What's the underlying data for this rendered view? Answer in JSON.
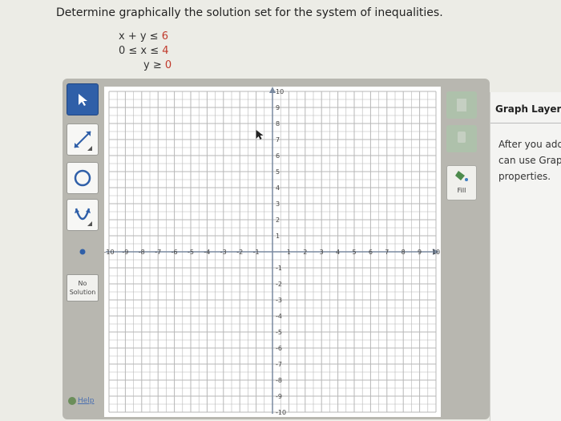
{
  "question": "Determine graphically the solution set for the system of inequalities.",
  "inequalities": [
    {
      "lhs": "x + y ≤ ",
      "rhs": "6"
    },
    {
      "lhs": "0 ≤ x ≤ ",
      "rhs": "4"
    },
    {
      "lhs": "y ≥ ",
      "rhs": "0"
    }
  ],
  "toolbar": {
    "tools": [
      "pointer-icon",
      "line-icon",
      "circle-icon",
      "parabola-icon",
      "point-icon"
    ],
    "no_solution": "No Solution",
    "help": "Help"
  },
  "graph": {
    "x_range": [
      -10,
      10
    ],
    "y_range": [
      -10,
      10
    ],
    "x_ticks": [
      -10,
      -9,
      -8,
      -7,
      -6,
      -5,
      -4,
      -3,
      -2,
      -1,
      1,
      2,
      3,
      4,
      5,
      6,
      7,
      8,
      9,
      10
    ],
    "y_ticks": [
      10,
      9,
      8,
      7,
      6,
      5,
      4,
      3,
      2,
      1,
      -1,
      -2,
      -3,
      -4,
      -5,
      -6,
      -7,
      -8,
      -9,
      -10
    ],
    "grid": true,
    "x_tick_labels": [
      "-10",
      "-9",
      "-8",
      "-7",
      "-6",
      "-5",
      "-4",
      "-3",
      "-2",
      "-1",
      "1",
      "2",
      "3",
      "4",
      "5",
      "6",
      "7",
      "8",
      "9",
      "10"
    ],
    "y_tick_labels": [
      "10",
      "9",
      "8",
      "7",
      "6",
      "5",
      "4",
      "3",
      "2",
      "1",
      "-1",
      "-2",
      "-3",
      "-4",
      "-5",
      "-6",
      "-7",
      "-8",
      "-9",
      "-10"
    ]
  },
  "side_buttons": {
    "fill_label": "Fill"
  },
  "layers": {
    "title": "Graph Layers",
    "text_lines": [
      "After you add",
      "can use Grapl",
      "properties."
    ]
  },
  "colors": {
    "accent": "#2f5fa8",
    "grid": "#b7b7b7",
    "inequality_num": "#c0392b"
  }
}
